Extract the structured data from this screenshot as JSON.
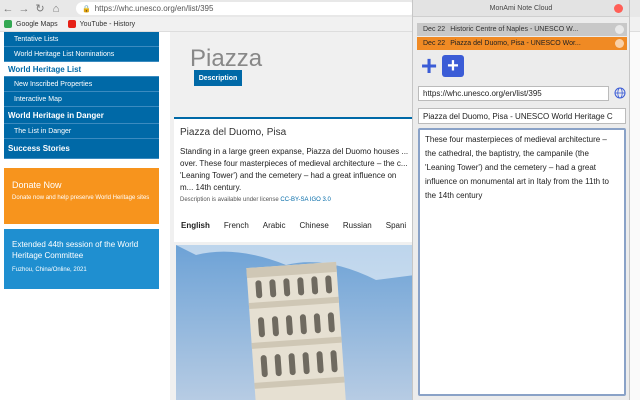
{
  "browser": {
    "url": "https://whc.unesco.org/en/list/395",
    "bookmarks": [
      "Google Maps",
      "YouTube - History"
    ]
  },
  "sidebar": {
    "items": [
      {
        "label": "Tentative Lists"
      },
      {
        "label": "World Heritage List Nominations"
      },
      {
        "label": "World Heritage List"
      },
      {
        "label": "New Inscribed Properties"
      },
      {
        "label": "Interactive Map"
      },
      {
        "label": "World Heritage in Danger"
      },
      {
        "label": "The List in Danger"
      },
      {
        "label": "Success Stories"
      }
    ],
    "donate": {
      "title": "Donate Now",
      "text": "Donate now and help preserve World Heritage sites"
    },
    "session": {
      "title": "Extended 44th session of the World Heritage Committee",
      "place": "Fuzhou, China/Online, 2021"
    }
  },
  "main": {
    "page_title": "Piazza",
    "tab_description": "Description",
    "site_name": "Piazza del Duomo, Pisa",
    "description": "Standing in a large green expanse, Piazza del Duomo houses ... over. These four masterpieces of medieval architecture – the c... 'Leaning Tower') and the cemetery – had a great influence on m... 14th century.",
    "license_text": "Description is available under license",
    "license_link": "CC-BY-SA IGO 3.0",
    "languages": [
      "English",
      "French",
      "Arabic",
      "Chinese",
      "Russian",
      "Spani"
    ]
  },
  "notecloud": {
    "title": "MonAmi Note Cloud",
    "notes": [
      {
        "date": "Dec 22",
        "title": "Historic Centre of Naples - UNESCO W..."
      },
      {
        "date": "Dec 22",
        "title": "Piazza del Duomo, Pisa - UNESCO Wor..."
      }
    ],
    "url_value": "https://whc.unesco.org/en/list/395",
    "title_value": "Piazza del Duomo, Pisa - UNESCO World Heritage C",
    "note_text": "These four masterpieces of medieval architecture – the cathedral, the baptistry, the campanile (the 'Leaning Tower') and the cemetery – had a great influence on monumental art in Italy from the 11th to the 14th century"
  }
}
